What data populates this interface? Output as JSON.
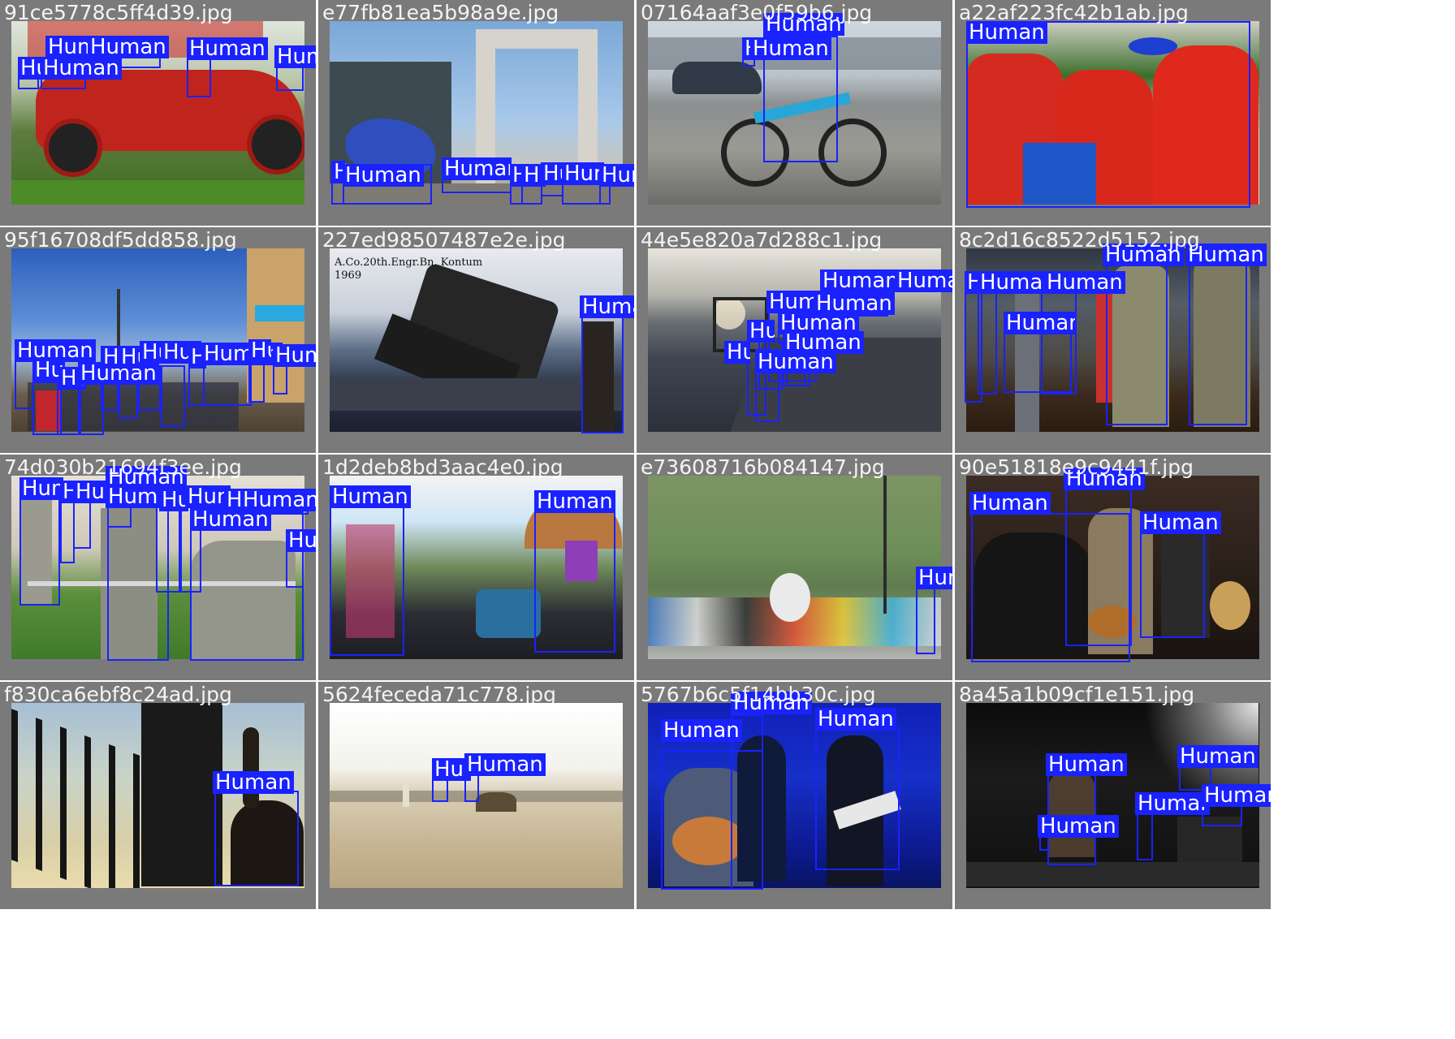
{
  "label": "Human",
  "colors": {
    "box": "#1a22ff",
    "tile_bg": "#7a7a7a",
    "label_text": "#ffffff"
  },
  "tiles": [
    {
      "filename": "91ce5778c5ff4d39.jpg"
    },
    {
      "filename": "e77fb81ea5b98a9e.jpg"
    },
    {
      "filename": "07164aaf3e0f59b6.jpg"
    },
    {
      "filename": "a22af223fc42b1ab.jpg"
    },
    {
      "filename": "95f16708df5dd858.jpg"
    },
    {
      "filename": "227ed98507487e2e.jpg",
      "overlay_text": [
        "A.Co.20th.Engr.Bn. Kontum",
        "1969"
      ]
    },
    {
      "filename": "44e5e820a7d288c1.jpg"
    },
    {
      "filename": "8c2d16c8522d5152.jpg"
    },
    {
      "filename": "74d030b21694f3ee.jpg"
    },
    {
      "filename": "1d2deb8bd3aac4e0.jpg"
    },
    {
      "filename": "e73608716b084147.jpg"
    },
    {
      "filename": "90e51818e9c9441f.jpg"
    },
    {
      "filename": "f830ca6ebf8c24ad.jpg"
    },
    {
      "filename": "5624feceda71c778.jpg"
    },
    {
      "filename": "5767b6c5f14bb30c.jpg"
    },
    {
      "filename": "8a45a1b09cf1e151.jpg"
    }
  ]
}
